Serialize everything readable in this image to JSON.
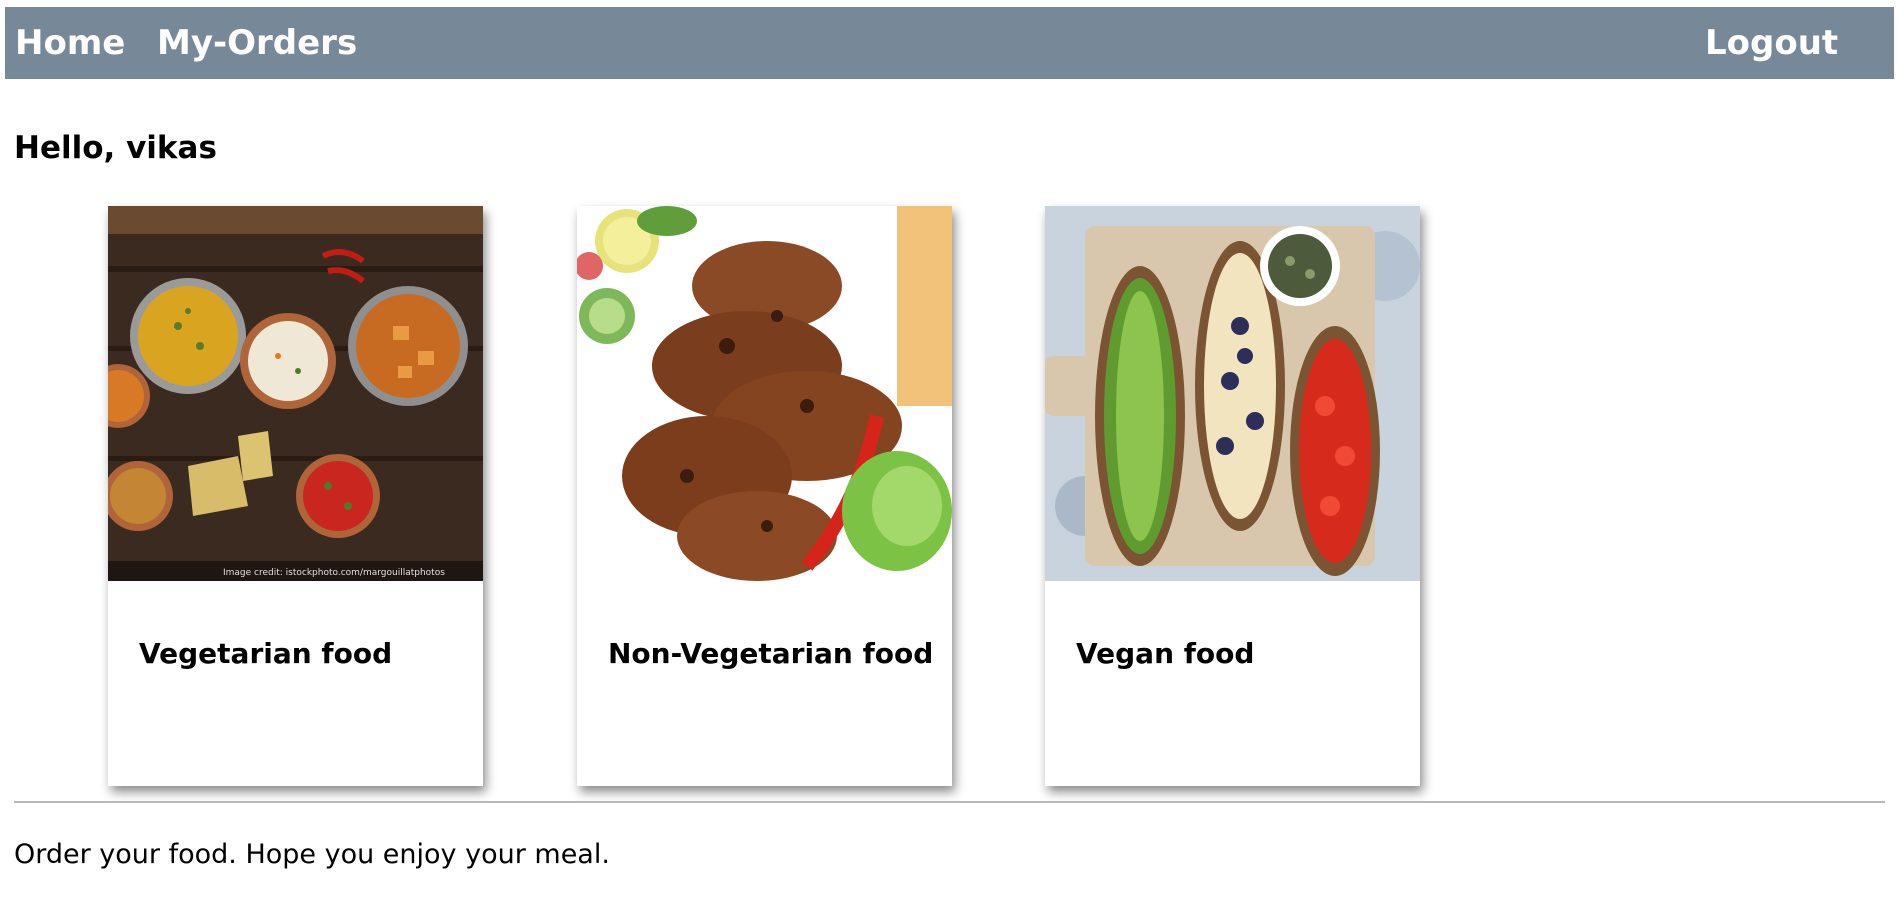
{
  "navbar": {
    "home_label": "Home",
    "orders_label": "My-Orders",
    "logout_label": "Logout",
    "background": "#778899"
  },
  "greeting": "Hello, vikas",
  "cards": [
    {
      "title": "Vegetarian food",
      "image": "vegetarian-thali-image",
      "image_credit": "Image credit: istockphoto.com/margouillatphotos"
    },
    {
      "title": "Non-Vegetarian food",
      "image": "grilled-kebab-image"
    },
    {
      "title": "Vegan food",
      "image": "vegan-toasts-image"
    }
  ],
  "footer": {
    "text": "Order your food. Hope you enjoy your meal."
  }
}
